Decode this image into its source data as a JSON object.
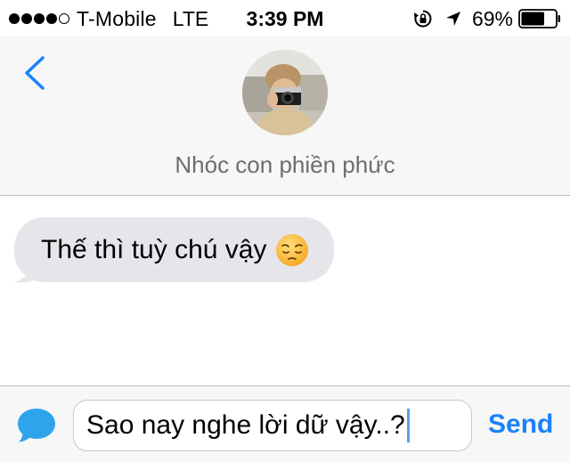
{
  "status_bar": {
    "signal_bars_filled": 4,
    "signal_bars_total": 5,
    "carrier": "T-Mobile",
    "network": "LTE",
    "time": "3:39 PM",
    "icons": [
      "rotation-lock-icon",
      "location-arrow-icon"
    ],
    "battery_percent": "69%",
    "battery_level": 0.69
  },
  "nav": {
    "back_icon": "chevron-left-icon",
    "contact_name": "Nhóc con phiền phức",
    "accent_color": "#1a82fb"
  },
  "messages": [
    {
      "direction": "incoming",
      "text": "Thế thì tuỳ chú vậy",
      "emoji": "pensive-face-emoji"
    }
  ],
  "composer": {
    "icon": "chat-bubble-icon",
    "text": "Sao nay nghe lời dữ vậy..?",
    "send_label": "Send"
  }
}
